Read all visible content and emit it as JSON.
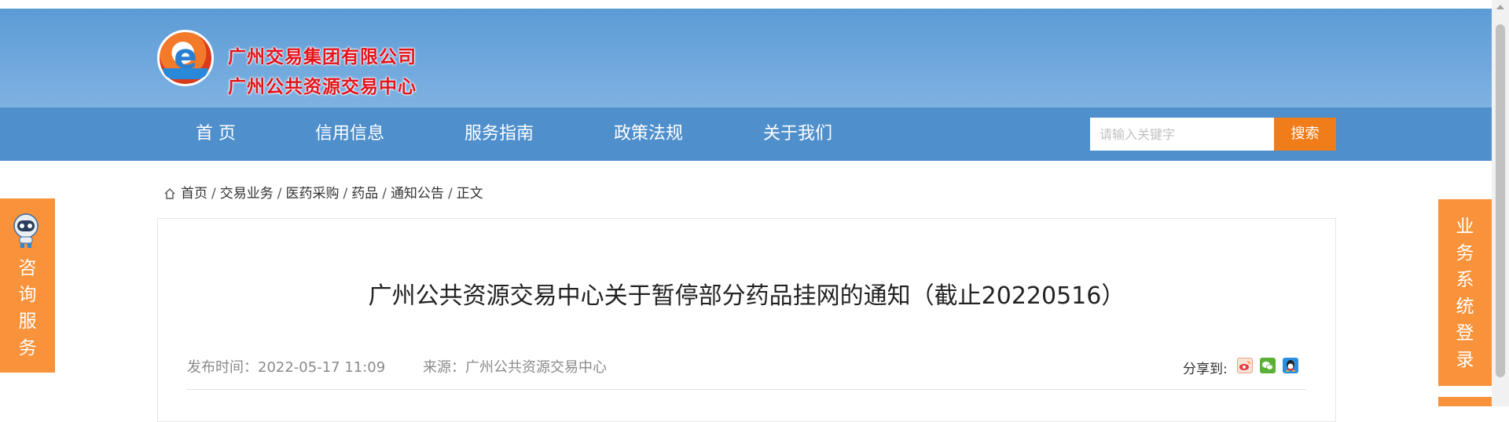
{
  "header": {
    "org_line1": "广州交易集团有限公司",
    "org_line2": "广州公共资源交易中心",
    "logo_icon": "e-logo-icon"
  },
  "nav": {
    "items": [
      "首 页",
      "信用信息",
      "服务指南",
      "政策法规",
      "关于我们"
    ],
    "search_placeholder": "请输入关键字",
    "search_button": "搜索"
  },
  "breadcrumb": {
    "icon": "home-icon",
    "items": [
      "首页",
      "交易业务",
      "医药采购",
      "药品",
      "通知公告",
      "正文"
    ],
    "separator": "/"
  },
  "article": {
    "title": "广州公共资源交易中心关于暂停部分药品挂网的通知（截止20220516）",
    "publish_time": "发布时间：2022-05-17 11:09",
    "source": "来源：广州公共资源交易中心",
    "share_label": "分享到:",
    "share_icons": [
      "weibo-icon",
      "wechat-icon",
      "qq-icon"
    ]
  },
  "left_float": {
    "icon": "robot-icon",
    "chars": [
      "咨",
      "询",
      "服",
      "务"
    ]
  },
  "right_float": {
    "chars": [
      "业",
      "务",
      "系",
      "统",
      "登",
      "录"
    ]
  },
  "colors": {
    "nav": "#4f8fcc",
    "header": "#6aa4da",
    "accent": "#f07c1a",
    "float": "#f8933b",
    "org_text": "#e3141c"
  }
}
